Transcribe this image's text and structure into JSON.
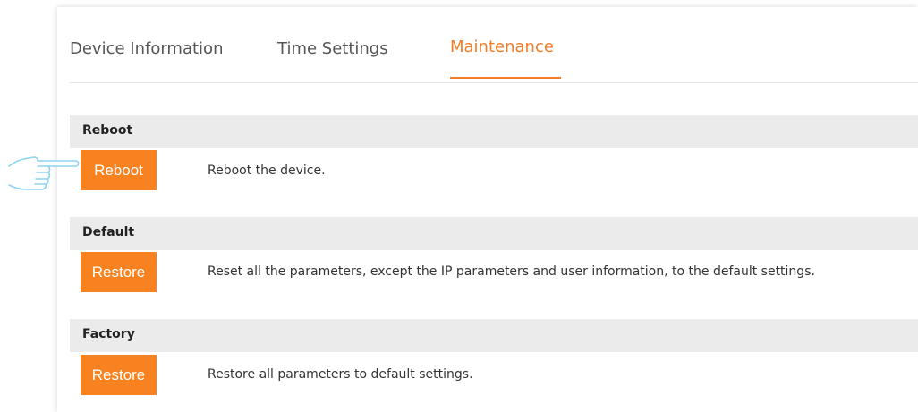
{
  "tabs": [
    {
      "label": "Device Information"
    },
    {
      "label": "Time Settings"
    },
    {
      "label": "Maintenance"
    }
  ],
  "sections": [
    {
      "title": "Reboot",
      "button_label": "Reboot",
      "description": "Reboot the device."
    },
    {
      "title": "Default",
      "button_label": "Restore",
      "description": "Reset all the parameters, except the IP parameters and user information, to the default settings."
    },
    {
      "title": "Factory",
      "button_label": "Restore",
      "description": "Restore all parameters to default settings."
    }
  ],
  "colors": {
    "accent": "#f27d27",
    "button": "#f7821f",
    "section_bg": "#ebebeb",
    "pointer_outline": "#8fd3f0"
  },
  "icons": {
    "pointer": "pointing-hand-icon"
  }
}
